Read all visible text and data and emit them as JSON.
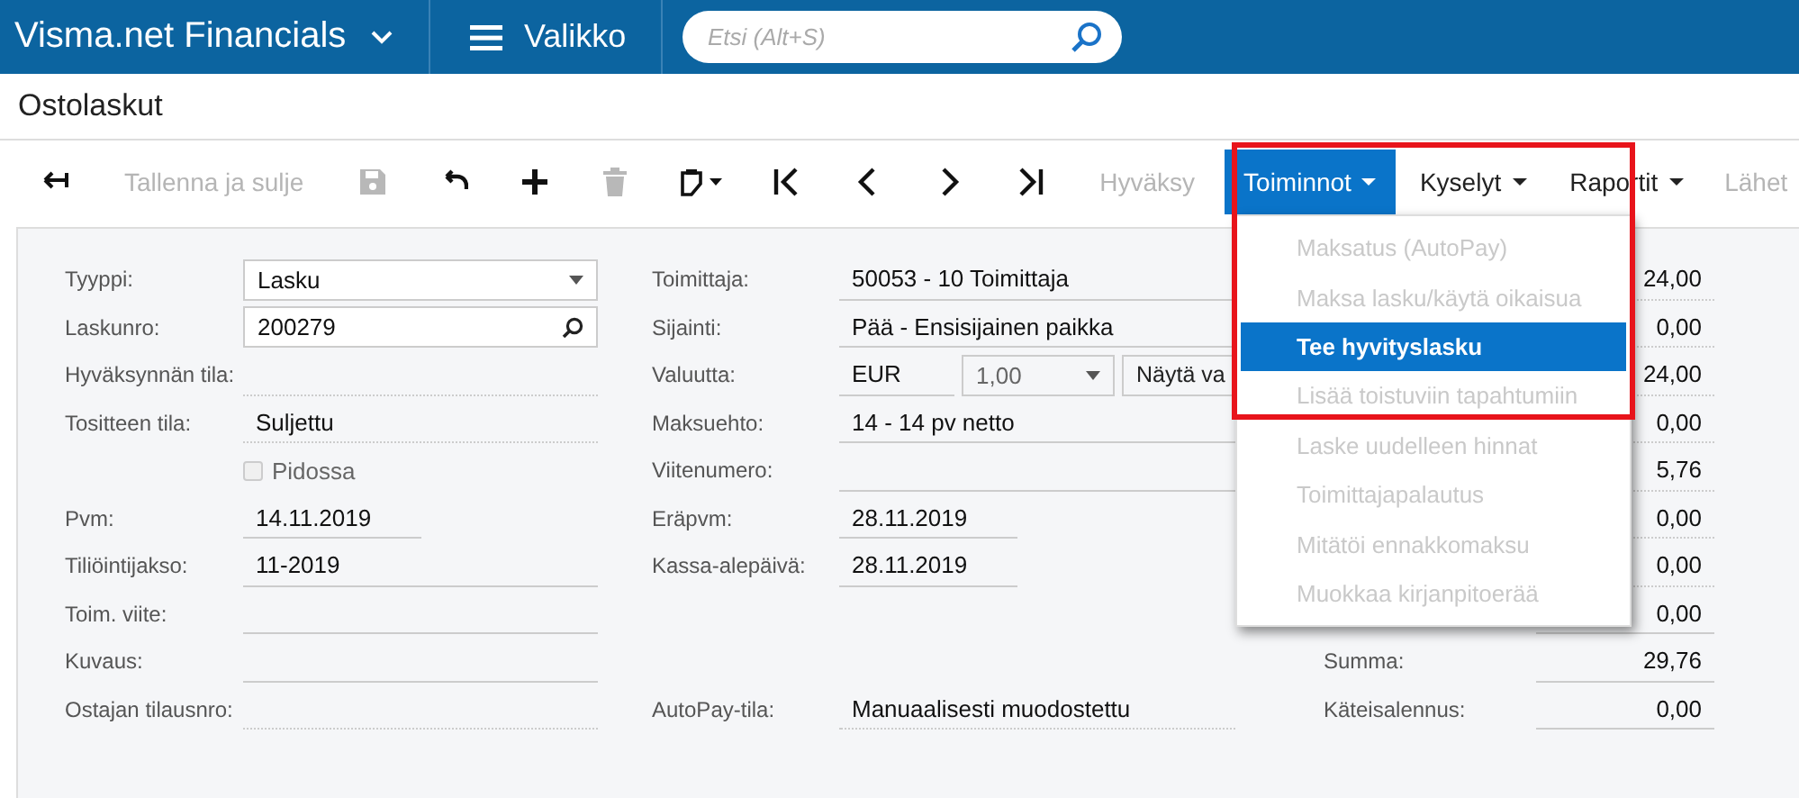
{
  "app_bar": {
    "product": "Visma.net Financials",
    "menu_label": "Valikko",
    "search": {
      "placeholder": "Etsi (Alt+S)"
    }
  },
  "page_title": "Ostolaskut",
  "toolbar": [
    {
      "kind": "back",
      "disabled": false,
      "selected": false
    },
    {
      "kind": "text",
      "label": "Tallenna ja sulje",
      "disabled": true,
      "selected": false
    },
    {
      "kind": "save",
      "disabled": true,
      "selected": false
    },
    {
      "kind": "undo",
      "disabled": false,
      "selected": false
    },
    {
      "kind": "add",
      "disabled": false,
      "selected": false
    },
    {
      "kind": "delete",
      "disabled": true,
      "selected": false
    },
    {
      "kind": "clipboard",
      "disabled": false,
      "selected": false
    },
    {
      "kind": "first",
      "disabled": false,
      "selected": false
    },
    {
      "kind": "prev",
      "disabled": false,
      "selected": false
    },
    {
      "kind": "next",
      "disabled": false,
      "selected": false
    },
    {
      "kind": "last",
      "disabled": false,
      "selected": false
    },
    {
      "kind": "text",
      "label": "Hyväksy",
      "disabled": true,
      "selected": false
    },
    {
      "kind": "menu",
      "label": "Toiminnot",
      "disabled": false,
      "selected": true
    },
    {
      "kind": "menu",
      "label": "Kyselyt",
      "disabled": false,
      "selected": false
    },
    {
      "kind": "menu",
      "label": "Raportit",
      "disabled": false,
      "selected": false
    },
    {
      "kind": "text",
      "label": "Lähet",
      "disabled": true,
      "selected": false
    }
  ],
  "form": {
    "left_fields": [
      {
        "kind": "select",
        "label": "Tyyppi:",
        "value": "Lasku"
      },
      {
        "kind": "lookup",
        "label": "Laskunro:",
        "value": "200279"
      },
      {
        "kind": "readonly",
        "label": "Hyväksynnän tila:"
      },
      {
        "kind": "readonly",
        "label": "Tositteen tila:",
        "value": "Suljettu"
      },
      {
        "kind": "checkbox",
        "label": "Pidossa",
        "checked": false,
        "disabled": true
      },
      {
        "kind": "date",
        "label": "Pvm:",
        "value": "14.11.2019"
      },
      {
        "kind": "text",
        "label": "Tiliöintijakso:",
        "value": "11-2019"
      },
      {
        "kind": "text",
        "label": "Toim. viite:"
      },
      {
        "kind": "text",
        "label": "Kuvaus:"
      },
      {
        "kind": "readonly",
        "label": "Ostajan tilausnro:"
      }
    ],
    "middle_fields": [
      {
        "kind": "text",
        "label": "Toimittaja:",
        "value": "50053 - 10 Toimittaja"
      },
      {
        "kind": "text",
        "label": "Sijainti:",
        "value": "Pää - Ensisijainen paikka"
      },
      {
        "kind": "currency",
        "label": "Valuutta:",
        "currency": "EUR",
        "rate": "1,00",
        "button": "Näytä va"
      },
      {
        "kind": "text",
        "label": "Maksuehto:",
        "value": "14 - 14 pv netto"
      },
      {
        "kind": "text",
        "label": "Viitenumero:"
      },
      {
        "kind": "date",
        "label": "Eräpvm:",
        "value": "28.11.2019"
      },
      {
        "kind": "date",
        "label": "Kassa-alepäivä:",
        "value": "28.11.2019"
      },
      {
        "kind": "readonly",
        "label": "AutoPay-tila:",
        "value": "Manuaalisesti muodostettu"
      }
    ],
    "totals": [
      {
        "value": "24,00"
      },
      {
        "value": "0,00"
      },
      {
        "value": "24,00"
      },
      {
        "value": "0,00"
      },
      {
        "value": "5,76"
      },
      {
        "value": "0,00"
      },
      {
        "value": "0,00"
      },
      {
        "value": "0,00"
      },
      {
        "label": "Summa:",
        "value": "29,76"
      },
      {
        "label": "Käteisalennus:",
        "value": "0,00"
      }
    ]
  },
  "actions_menu": {
    "highlight_frame": true,
    "items": [
      {
        "label": "Maksatus (AutoPay)",
        "disabled": true,
        "selected": false
      },
      {
        "label": "Maksa lasku/käytä oikaisua",
        "disabled": true,
        "selected": false
      },
      {
        "label": "Tee hyvityslasku",
        "disabled": false,
        "selected": true
      },
      {
        "label": "Lisää toistuviin tapahtumiin",
        "disabled": true,
        "selected": false
      },
      {
        "label": "Laske uudelleen hinnat",
        "disabled": true,
        "selected": false
      },
      {
        "label": "Toimittajapalautus",
        "disabled": true,
        "selected": false
      },
      {
        "label": "Mitätöi ennakkomaksu",
        "disabled": true,
        "selected": false
      },
      {
        "label": "Muokkaa kirjanpitoerää",
        "disabled": true,
        "selected": false
      }
    ]
  }
}
